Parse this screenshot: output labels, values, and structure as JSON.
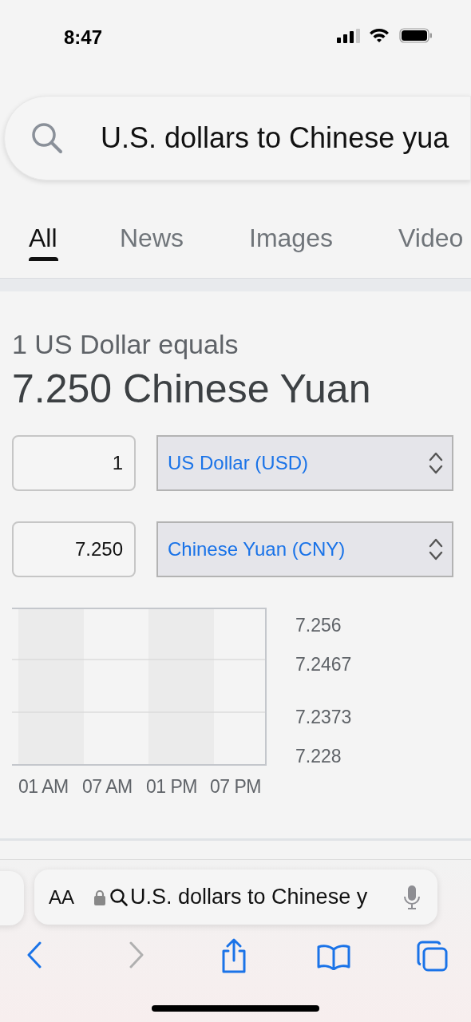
{
  "status_bar": {
    "time": "8:47"
  },
  "search": {
    "query": "U.S. dollars to Chinese yua"
  },
  "tabs": [
    {
      "label": "All",
      "selected": true
    },
    {
      "label": "News",
      "selected": false
    },
    {
      "label": "Images",
      "selected": false
    },
    {
      "label": "Video",
      "selected": false
    }
  ],
  "converter": {
    "headline": "1 US Dollar equals",
    "result": "7.250 Chinese Yuan",
    "rows": [
      {
        "amount": "1",
        "currency": "US Dollar (USD)"
      },
      {
        "amount": "7.250",
        "currency": "Chinese Yuan (CNY)"
      }
    ]
  },
  "chart": {
    "y_labels": [
      "7.256",
      "7.2467",
      "7.2373",
      "7.228"
    ],
    "x_labels": [
      "01 AM",
      "07 AM",
      "01 PM",
      "07 PM"
    ]
  },
  "address_bar": {
    "text_size": "AA",
    "url": "U.S. dollars to Chinese y"
  }
}
